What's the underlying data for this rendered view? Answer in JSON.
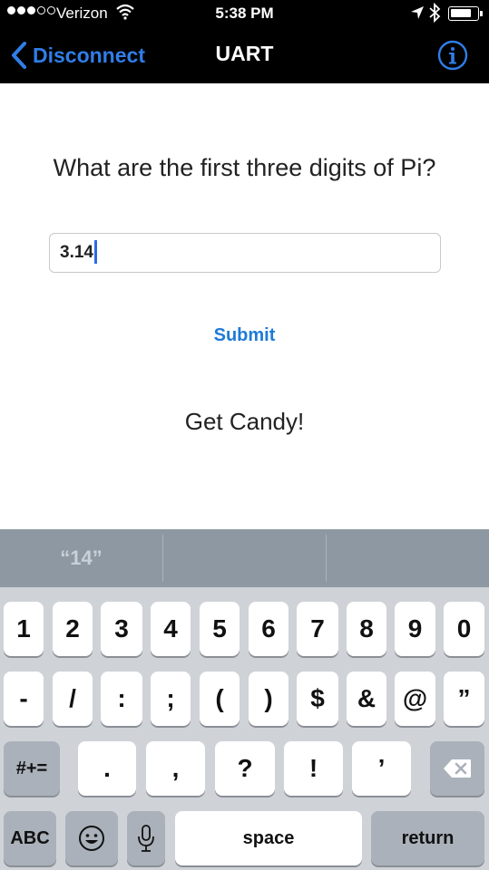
{
  "status_bar": {
    "carrier": "Verizon",
    "time": "5:38 PM",
    "signal_bars_filled": 3,
    "signal_bars_total": 5,
    "icons": [
      "wifi-icon",
      "location-arrow-icon",
      "bluetooth-icon",
      "battery-icon"
    ]
  },
  "nav": {
    "back_label": "Disconnect",
    "title": "UART",
    "info_icon": "info-icon"
  },
  "content": {
    "question": "What are the first three digits of Pi?",
    "answer_value": "3.14",
    "submit_label": "Submit",
    "result": "Get Candy!"
  },
  "keyboard": {
    "suggestions": [
      "“14”",
      "",
      ""
    ],
    "row1": [
      "1",
      "2",
      "3",
      "4",
      "5",
      "6",
      "7",
      "8",
      "9",
      "0"
    ],
    "row2": [
      "-",
      "/",
      ":",
      ";",
      "(",
      ")",
      "$",
      "&",
      "@",
      "”"
    ],
    "row3": {
      "mode": "#+=",
      "keys": [
        ".",
        ",",
        "?",
        "!",
        "’"
      ],
      "delete_icon": "backspace-icon"
    },
    "row4": {
      "abc": "ABC",
      "emoji_icon": "emoji-icon",
      "mic_icon": "microphone-icon",
      "space": "space",
      "return": "return"
    }
  },
  "colors": {
    "accent": "#2f7ee8",
    "nav_background": "#000000",
    "keyboard_background": "#cfd3d8",
    "suggestion_bar": "#8e98a2"
  }
}
